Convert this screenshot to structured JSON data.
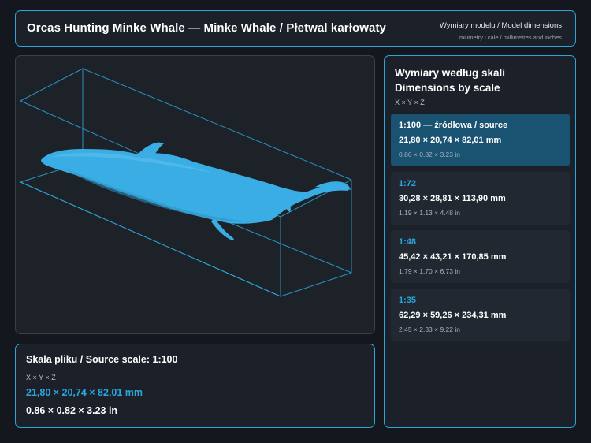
{
  "header": {
    "title": "Orcas Hunting Minke Whale — Minke Whale / Płetwal karłowaty",
    "subtitle": "Wymiary modelu / Model dimensions",
    "units_note": "milimetry i cale / millimetres and inches"
  },
  "viewer": {
    "model_color": "#3aaee4",
    "box_color": "#2aa6dc"
  },
  "source": {
    "title": "Skala pliku / Source scale: 1:100",
    "axes": "X × Y × Z",
    "dims_mm": "21,80 × 20,74 × 82,01 mm",
    "dims_in": "0.86 × 0.82 × 3.23 in"
  },
  "scales": {
    "title_line1": "Wymiary według skali",
    "title_line2": "Dimensions by scale",
    "axes": "X × Y × Z",
    "items": [
      {
        "label": "1:100  —  źródłowa / source",
        "mm": "21,80 × 20,74 × 82,01 mm",
        "in": "0.86 × 0.82 × 3.23 in",
        "active": true
      },
      {
        "label": "1:72",
        "mm": "30,28 × 28,81 × 113,90 mm",
        "in": "1.19 × 1.13 × 4.48 in",
        "active": false
      },
      {
        "label": "1:48",
        "mm": "45,42 × 43,21 × 170,85 mm",
        "in": "1.79 × 1.70 × 6.73 in",
        "active": false
      },
      {
        "label": "1:35",
        "mm": "62,29 × 59,26 × 234,31 mm",
        "in": "2.45 × 2.33 × 9.22 in",
        "active": false
      }
    ]
  },
  "colors": {
    "accent": "#2aa6dc",
    "background": "#14181e",
    "panel": "#1b2029",
    "active_card": "#1a5272"
  }
}
